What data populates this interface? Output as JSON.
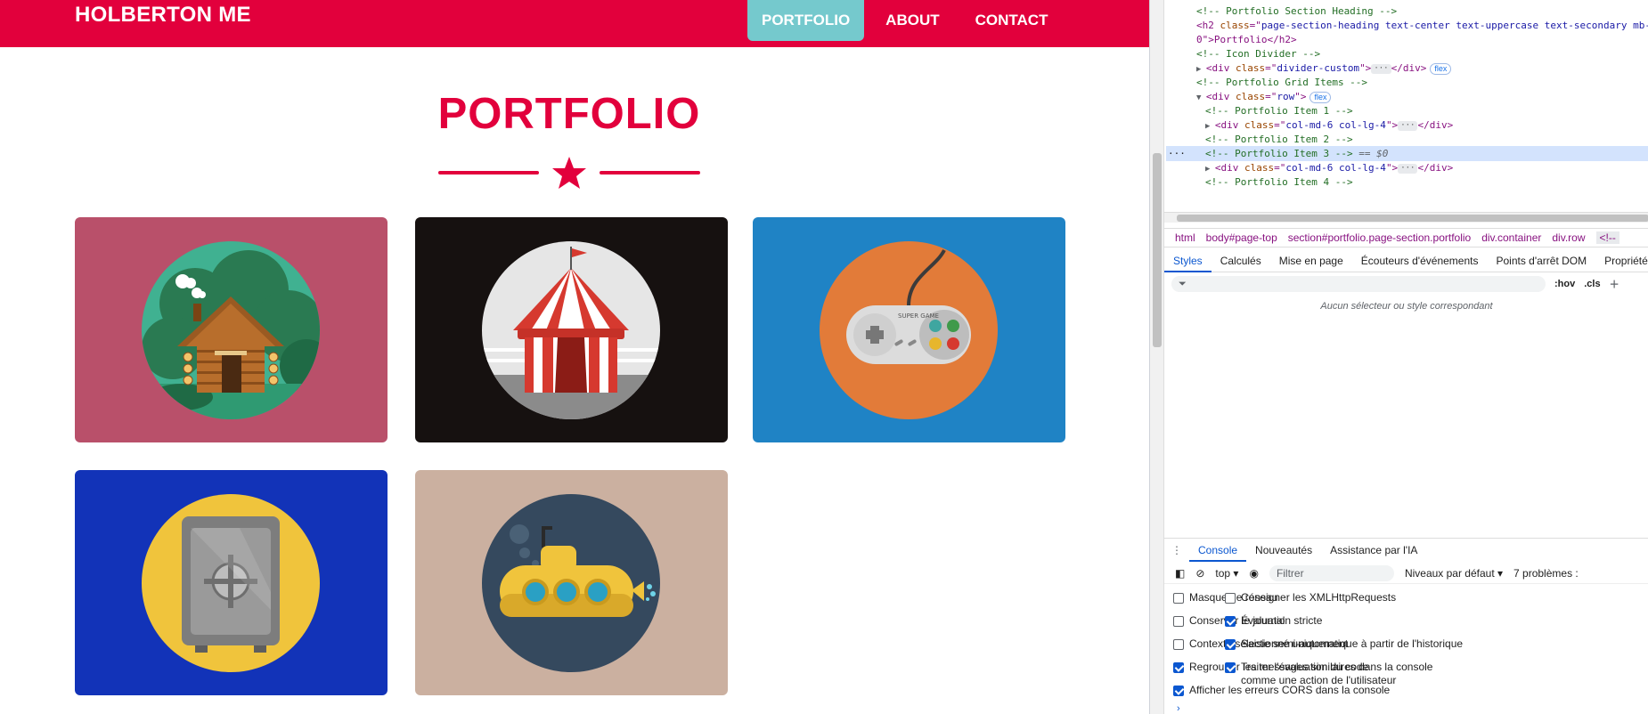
{
  "site": {
    "brand": "HOLBERTON ME",
    "nav": [
      {
        "label": "PORTFOLIO",
        "active": true
      },
      {
        "label": "ABOUT",
        "active": false
      },
      {
        "label": "CONTACT",
        "active": false
      }
    ],
    "heading": "PORTFOLIO",
    "cards": [
      {
        "name": "cabin",
        "bg": "#b9506a"
      },
      {
        "name": "circus-tent",
        "bg": "#161110"
      },
      {
        "name": "game-controller",
        "bg": "#1f83c5"
      },
      {
        "name": "safe",
        "bg": "#1233b8"
      },
      {
        "name": "submarine",
        "bg": "#cbb0a0"
      }
    ],
    "controller_brand": "SUPER GAME",
    "colors": {
      "primary": "#e2003c",
      "nav_active": "#75c9cd"
    }
  },
  "devtools": {
    "elements": [
      {
        "kind": "comment",
        "text": "<!-- Portfolio Section Heading -->",
        "indent": 1
      },
      {
        "kind": "h2",
        "tag": "h2",
        "attr": "class",
        "value": "page-section-heading text-center text-uppercase text-secondary mb-",
        "indent": 1
      },
      {
        "kind": "h2b",
        "text": "0\">Portfolio</h2>",
        "indent": 1
      },
      {
        "kind": "comment",
        "text": "<!-- Icon Divider -->",
        "indent": 1
      },
      {
        "kind": "collapsed",
        "tag": "div",
        "attr": "class",
        "value": "divider-custom",
        "badge": "flex",
        "indent": 1
      },
      {
        "kind": "comment",
        "text": "<!-- Portfolio Grid Items -->",
        "indent": 1
      },
      {
        "kind": "open",
        "tag": "div",
        "attr": "class",
        "value": "row",
        "badge": "flex",
        "indent": 1
      },
      {
        "kind": "comment",
        "text": "<!-- Portfolio Item 1 -->",
        "indent": 2
      },
      {
        "kind": "collapsed",
        "tag": "div",
        "attr": "class",
        "value": "col-md-6 col-lg-4",
        "badge": "",
        "indent": 2
      },
      {
        "kind": "comment",
        "text": "<!-- Portfolio Item 2 -->",
        "indent": 2
      },
      {
        "kind": "selected",
        "text": "<!-- Portfolio Item 3 -->",
        "suffix": " == $0",
        "indent": 2
      },
      {
        "kind": "collapsed",
        "tag": "div",
        "attr": "class",
        "value": "col-md-6 col-lg-4",
        "badge": "",
        "indent": 2
      },
      {
        "kind": "comment",
        "text": "<!-- Portfolio Item 4 -->",
        "indent": 2
      }
    ],
    "breadcrumbs": [
      "html",
      "body#page-top",
      "section#portfolio.page-section.portfolio",
      "div.container",
      "div.row",
      "<!--"
    ],
    "style_tabs": [
      "Styles",
      "Calculés",
      "Mise en page",
      "Écouteurs d'événements",
      "Points d'arrêt DOM",
      "Propriétés"
    ],
    "filter_placeholder": "Filtrer",
    "hov": ":hov",
    "cls": ".cls",
    "no_match": "Aucun sélecteur ou style correspondant",
    "console_tabs": [
      "Console",
      "Nouveautés",
      "Assistance par l'IA"
    ],
    "console_context": "top",
    "console_filter": "Filtrer",
    "console_levels": "Niveaux par défaut",
    "console_issues": "7 problèmes :",
    "options_left": [
      {
        "label": "Masquer le réseau",
        "checked": false
      },
      {
        "label": "Conserver le journal",
        "checked": false
      },
      {
        "label": "Contexte sélectionné uniquement",
        "checked": false
      },
      {
        "label": "Regrouper les messages similaires dans la console",
        "checked": true
      },
      {
        "label": "Afficher les erreurs CORS dans la console",
        "checked": true
      }
    ],
    "options_right": [
      {
        "label": "Consigner les XMLHttpRequests",
        "checked": false
      },
      {
        "label": "Évaluation stricte",
        "checked": true
      },
      {
        "label": "Saisie semi-automatique à partir de l'historique",
        "checked": true
      },
      {
        "label": "Traiter l'évaluation du code comme une action de l'utilisateur",
        "checked": true
      }
    ]
  }
}
